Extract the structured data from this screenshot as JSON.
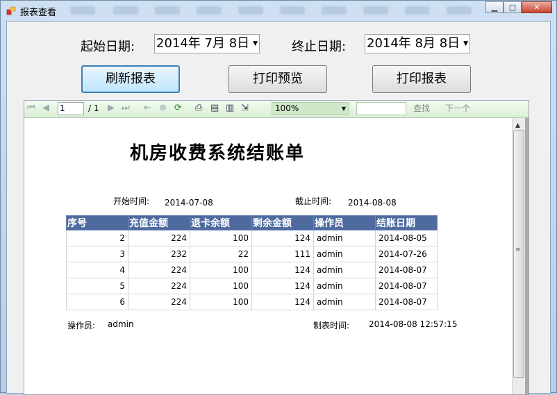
{
  "window": {
    "title": "报表查看",
    "minimize": "▁",
    "maximize": "□",
    "close": "✕"
  },
  "filters": {
    "start_label": "起始日期:",
    "start_value": "2014年  7月  8日",
    "end_label": "终止日期:",
    "end_value": "2014年  8月  8日"
  },
  "buttons": {
    "refresh": "刷新报表",
    "preview": "打印预览",
    "print": "打印报表"
  },
  "toolbar": {
    "page_current": "1",
    "page_total": "/ 1",
    "zoom": "100%",
    "find_label": "查找",
    "next_label": "下一个",
    "icons": [
      "first-page-icon",
      "prev-page-icon",
      "next-page-icon",
      "last-page-icon",
      "back-icon",
      "stop-icon",
      "refresh-icon",
      "print-icon",
      "page-setup-icon",
      "print-layout-icon",
      "export-icon"
    ]
  },
  "report": {
    "title": "机房收费系统结账单",
    "start_time_label": "开始时间:",
    "start_time_value": "2014-07-08",
    "end_time_label": "截止时间:",
    "end_time_value": "2014-08-08",
    "columns": [
      "序号",
      "充值金额",
      "退卡余额",
      "剩余金额",
      "操作员",
      "结账日期"
    ],
    "rows": [
      [
        "2",
        "224",
        "100",
        "124",
        "admin",
        "2014-08-05"
      ],
      [
        "3",
        "232",
        "22",
        "111",
        "admin",
        "2014-07-26"
      ],
      [
        "4",
        "224",
        "100",
        "124",
        "admin",
        "2014-08-07"
      ],
      [
        "5",
        "224",
        "100",
        "124",
        "admin",
        "2014-08-07"
      ],
      [
        "6",
        "224",
        "100",
        "124",
        "admin",
        "2014-08-07"
      ]
    ],
    "operator_label": "操作员:",
    "operator_value": "admin",
    "made_time_label": "制表时间:",
    "made_time_value": "2014-08-08 12:57:15"
  },
  "colors": {
    "header_bg": "#4e6a9f",
    "toolbar_bg": "#d9efd4",
    "focus_border": "#3c7fb1"
  }
}
